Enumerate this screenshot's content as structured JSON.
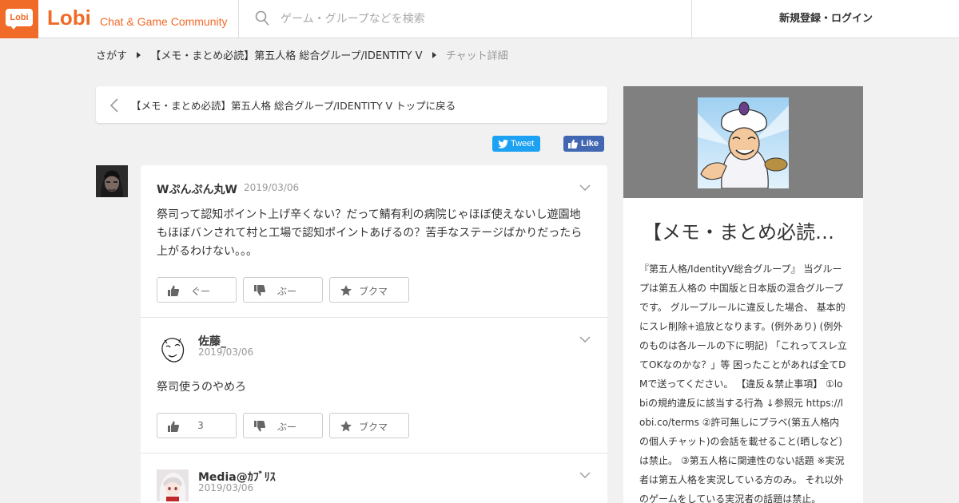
{
  "header": {
    "logo_mark": "Lobi",
    "logo_word": "Lobi",
    "tagline": "Chat & Game Community",
    "search_placeholder": "ゲーム・グループなどを検索",
    "login_label": "新規登録・ログイン"
  },
  "breadcrumb": {
    "items": [
      "さがす",
      "【メモ・まとめ必読】第五人格 総合グループ/IDENTITY V",
      "チャット詳細"
    ]
  },
  "back_bar": {
    "label": "【メモ・まとめ必読】第五人格 総合グループ/IDENTITY V トップに戻る"
  },
  "social": {
    "tweet_label": "Tweet",
    "like_label": "Like"
  },
  "posts": [
    {
      "author": "Wぷんぷん丸W",
      "date": "2019/03/06",
      "body": "祭司って認知ポイント上げ辛くない？だって鯖有利の病院じゃほぼ使えないし遊園地もほぼバンされて村と工場で認知ポイントあげるの？苦手なステージばかりだったら上がるわけない。。。",
      "reactions": {
        "good": "ぐー",
        "boo": "ぶー",
        "bookmark": "ブクマ"
      }
    },
    {
      "author": "佐藤_",
      "date": "2019/03/06",
      "body": "祭司使うのやめろ",
      "reactions": {
        "good": "3",
        "boo": "ぶー",
        "bookmark": "ブクマ"
      }
    },
    {
      "author": "Media@ｶﾌﾞﾘｽ",
      "date": "2019/03/06"
    }
  ],
  "sidebar": {
    "title": "【メモ・まとめ必読…",
    "description": "『第五人格/IdentityV総合グループ』 当グループは第五人格の 中国版と日本版の混合グループです。 グループルールに違反した場合、 基本的にスレ削除+追放となります。(例外あり) (例外のものは各ルールの下に明記) 「これってスレ立てOKなのかな？」等 困ったことがあれば全てDMで送ってください。 【違反＆禁止事項】 ①lobiの規約違反に該当する行為 ↓参照元 https://lobi.co/terms ②許可無しにプラベ(第五人格内の個人チャット)の会話を載せること(晒しなど)は禁止。 ③第五人格に関連性のない話題 ※実況者は第五人格を実況している方のみ。 それ以外のゲームをしている実況者の話題は禁止。"
  },
  "colors": {
    "brand": "#f16b28",
    "tweet": "#1da1f2",
    "facebook": "#4267b2",
    "banner_gray": "#808080"
  }
}
